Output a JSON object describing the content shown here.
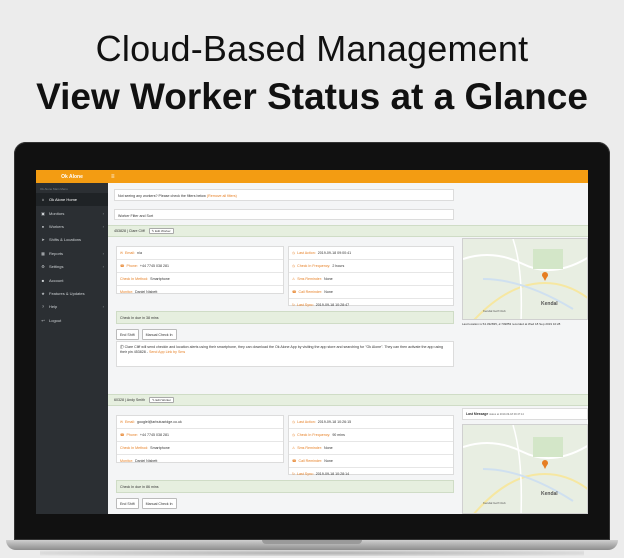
{
  "headline": {
    "line1": "Cloud-Based Management",
    "line2": "View Worker Status at a Glance"
  },
  "app": {
    "brand": "Ok Alone",
    "menu_icon": "hamburger-icon",
    "sidebar_header": "Ok Alone Main Menu",
    "sidebar": [
      {
        "label": "Ok Alone Home",
        "icon": "home-icon",
        "active": true
      },
      {
        "label": "Monitors",
        "icon": "monitor-icon",
        "chevron": true
      },
      {
        "label": "Workers",
        "icon": "users-icon",
        "chevron": true
      },
      {
        "label": "Shifts & Locations",
        "icon": "location-icon"
      },
      {
        "label": "Reports",
        "icon": "table-icon",
        "chevron": true
      },
      {
        "label": "Settings",
        "icon": "gear-icon",
        "chevron": true
      },
      {
        "label": "Account",
        "icon": "account-icon"
      },
      {
        "label": "Features & Updates",
        "icon": "star-icon"
      },
      {
        "label": "Help",
        "icon": "help-icon",
        "chevron": true
      },
      {
        "label": "Logout",
        "icon": "logout-icon"
      }
    ]
  },
  "main": {
    "notice_text": "Not seeing any workers? Please check the filters below",
    "notice_link": "(Remove all filters)",
    "filter_label": "Worker Filter and Sort",
    "edit_worker_label": "Edit Worker",
    "end_shift_label": "End Shift",
    "manual_checkin_label": "Manual Check In",
    "labels": {
      "email": "Email:",
      "phone": "Phone:",
      "checkin_method": "Check In Method:",
      "monitor": "Monitor:",
      "last_action": "Last Action:",
      "checkin_frequency": "Check In Frequency:",
      "sms_reminder": "Sms Reminder:",
      "call_reminder": "Call Reminder:",
      "last_sync": "Last Sync:"
    },
    "workers": [
      {
        "title": "453828 | Clare Cliff",
        "email": "n/a",
        "phone": "+44 7745 038 281",
        "checkin_method": "Smartphone",
        "monitor": "Daniel Nisbett",
        "last_action": "2019-09-18 09:00:41",
        "checkin_frequency": "2 hours",
        "sms_reminder": "None",
        "call_reminder": "None",
        "last_sync": "2019-09-18 10:28:47",
        "checkin_due": "Check In due in 38 mins",
        "info": "Clare Cliff will send checkin and location alerts using their smartphone, they can download the Ok Alone App by visiting the app store and searching for \"Ok Alone\". They can then activate the app using their pin 453828 -",
        "info_link": "Send App Link by Sms",
        "map_caption": "Last location is 54.332835,-2.749853 recorded at Wed 18 Sep 2019 10:28"
      },
      {
        "title": "60328 | Andy Smith",
        "email": "googlel@arbutusridge.co.uk",
        "phone": "+44 7745 038 281",
        "checkin_method": "Smartphone",
        "monitor": "Daniel Nisbett",
        "last_action": "2019-09-18 10:26:15",
        "checkin_frequency": "90 mins",
        "sms_reminder": "None",
        "call_reminder": "None",
        "last_sync": "2019-09-18 10:28:14",
        "checkin_due": "Check In due in 86 mins",
        "last_message_label": "Last Message",
        "last_message": "status at 2019-09-18 09:47:14"
      }
    ],
    "map_town": "Kendal",
    "map_place": "Kendal Golf Club"
  }
}
